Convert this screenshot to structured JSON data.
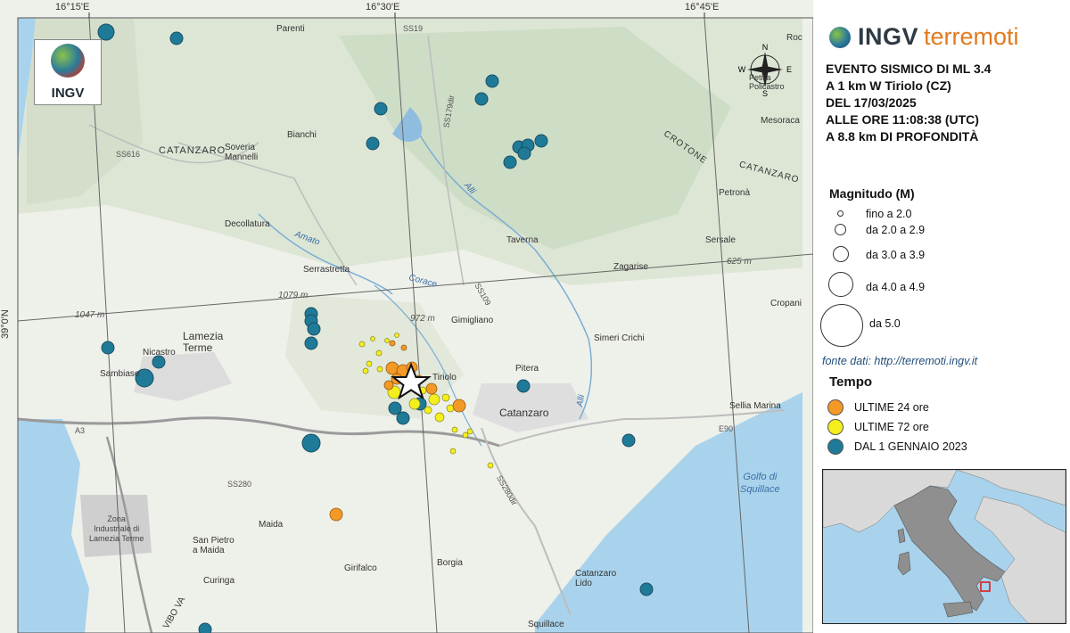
{
  "map": {
    "coords": {
      "lon1": "16°15'E",
      "lon2": "16°30'E",
      "lon3": "16°45'E",
      "lat1": "39°0'N"
    },
    "logo_text": "INGV",
    "places": [
      {
        "name": "Parenti"
      },
      {
        "name": "Soveria\nMannelli"
      },
      {
        "name": "Bianchi"
      },
      {
        "name": "CATANZARO"
      },
      {
        "name": "Decollatura"
      },
      {
        "name": "Serrastretta"
      },
      {
        "name": "Lamezia\nTerme"
      },
      {
        "name": "Nicastro"
      },
      {
        "name": "Sambiase"
      },
      {
        "name": "Gimigliano"
      },
      {
        "name": "Tiriolo"
      },
      {
        "name": "Pitera"
      },
      {
        "name": "Catanzaro"
      },
      {
        "name": "Taverna"
      },
      {
        "name": "Zagarise"
      },
      {
        "name": "Sersale"
      },
      {
        "name": "Petronà"
      },
      {
        "name": "Mesoraca"
      },
      {
        "name": "Cropani"
      },
      {
        "name": "Simeri Crichi"
      },
      {
        "name": "Sellia Marina"
      },
      {
        "name": "Maida"
      },
      {
        "name": "San Pietro\na Maida"
      },
      {
        "name": "Curinga"
      },
      {
        "name": "Girifalco"
      },
      {
        "name": "Borgia"
      },
      {
        "name": "Catanzaro\nLido"
      },
      {
        "name": "Squillace"
      },
      {
        "name": "Zona\nIndustriale di\nLamezia Terme"
      },
      {
        "name": "CROTONE"
      },
      {
        "name": "CATANZARO"
      },
      {
        "name": "VIBO VA"
      },
      {
        "name": "Roc"
      },
      {
        "name": "Petilia\nPolicastro"
      }
    ],
    "roads": [
      "SS616",
      "SS19",
      "SS179dir",
      "SS280",
      "SS280dir",
      "A3",
      "E90",
      "SS109"
    ],
    "water": [
      "Golfo di\nSquillace",
      "Amato",
      "Alli",
      "Alli",
      "Corace"
    ],
    "elevations": [
      "1079 m",
      "1047 m",
      "972 m",
      "625 m"
    ]
  },
  "event": {
    "line1": "EVENTO SISMICO DI ML 3.4",
    "line2": "A 1 km W Tiriolo (CZ)",
    "line3": "DEL 17/03/2025",
    "line4": "ALLE ORE 11:08:38 (UTC)",
    "line5": "A 8.8 km DI PROFONDITÀ"
  },
  "brand": {
    "name": "INGV",
    "sub": "terremoti"
  },
  "legend": {
    "magnitude_title": "Magnitudo (M)",
    "magnitude": [
      "fino a 2.0",
      "da 2.0 a 2.9",
      "da 3.0 a 3.9",
      "da 4.0 a 4.9",
      "da 5.0"
    ],
    "source": "fonte dati: http://terremoti.ingv.it",
    "time_title": "Tempo",
    "time": [
      {
        "label": "ULTIME 24 ore",
        "color": "#f39a26"
      },
      {
        "label": "ULTIME 72 ore",
        "color": "#f4ef1c"
      },
      {
        "label": "DAL 1 GENNAIO 2023",
        "color": "#1f7a97"
      }
    ]
  },
  "compass": {
    "n": "N",
    "s": "S",
    "e": "E",
    "w": "W"
  }
}
